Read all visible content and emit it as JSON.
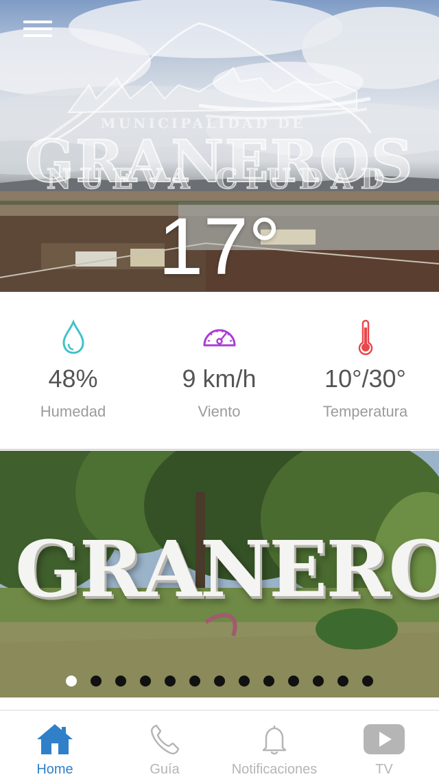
{
  "app": {
    "logo": {
      "line1": "MUNICIPALIDAD DE",
      "line2": "GRANEROS",
      "line3": "NUEVA CIUDAD"
    },
    "current_temperature": "17°"
  },
  "menu": {
    "icon": "hamburger-menu-icon"
  },
  "weather": {
    "stats": [
      {
        "icon": "water-drop-icon",
        "value": "48%",
        "label": "Humedad",
        "color": "#3fc1c9"
      },
      {
        "icon": "speedometer-icon",
        "value": "9 km/h",
        "label": "Viento",
        "color": "#a93cd6"
      },
      {
        "icon": "thermometer-icon",
        "value": "10°/30°",
        "label": "Temperatura",
        "color": "#e8474c"
      }
    ]
  },
  "carousel": {
    "sign_text": "GRANEROS",
    "total_slides": 13,
    "active_index": 0
  },
  "tabbar": {
    "active_color": "#2f80c9",
    "inactive_color": "#b5b5b5",
    "tabs": [
      {
        "label": "Home",
        "icon": "house-icon",
        "active": true
      },
      {
        "label": "Guía",
        "icon": "phone-icon",
        "active": false
      },
      {
        "label": "Notificaciones",
        "icon": "bell-icon",
        "active": false
      },
      {
        "label": "TV",
        "icon": "play-video-icon",
        "active": false
      }
    ]
  }
}
